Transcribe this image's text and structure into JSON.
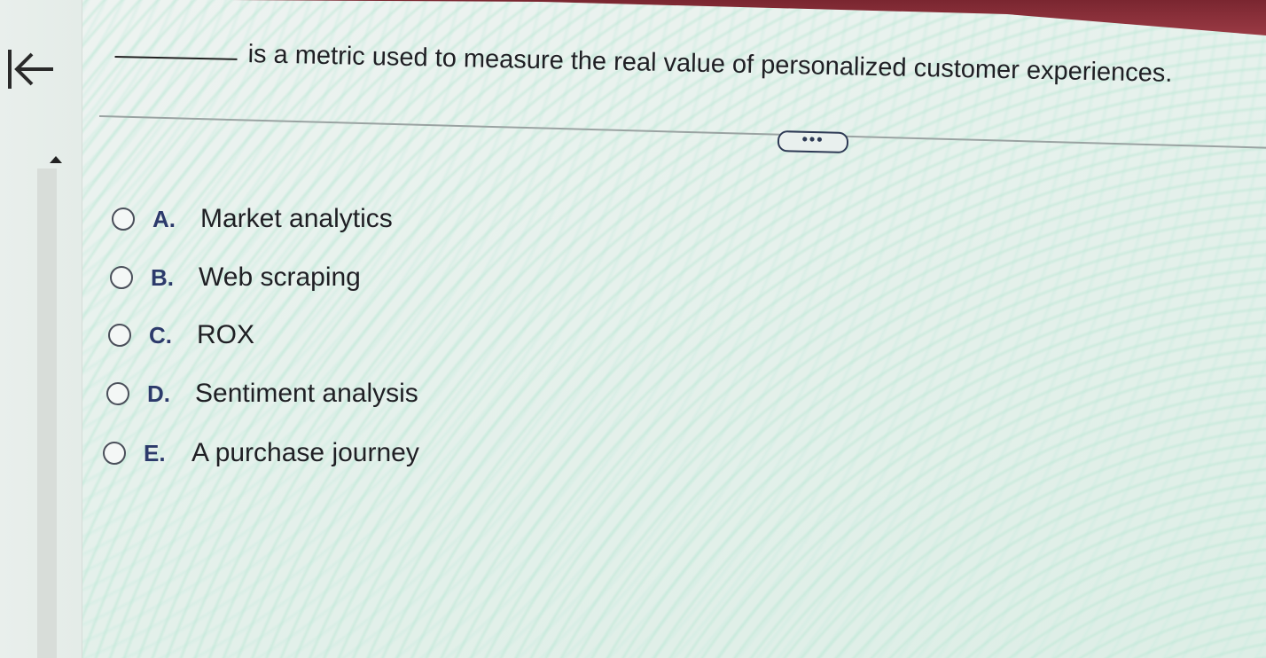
{
  "question": {
    "blank": "",
    "text": "is a metric used to measure the real value of personalized customer experiences."
  },
  "controls": {
    "expand_label": "•••"
  },
  "icons": {
    "back": "first-page-arrow-icon",
    "scroll_up": "triangle-up-icon"
  },
  "options": [
    {
      "letter": "A.",
      "text": "Market analytics"
    },
    {
      "letter": "B.",
      "text": "Web scraping"
    },
    {
      "letter": "C.",
      "text": "ROX"
    },
    {
      "letter": "D.",
      "text": "Sentiment analysis"
    },
    {
      "letter": "E.",
      "text": "A purchase journey"
    }
  ],
  "colors": {
    "accent_letter": "#2c3a6b",
    "top_strip": "#8a2f39"
  }
}
